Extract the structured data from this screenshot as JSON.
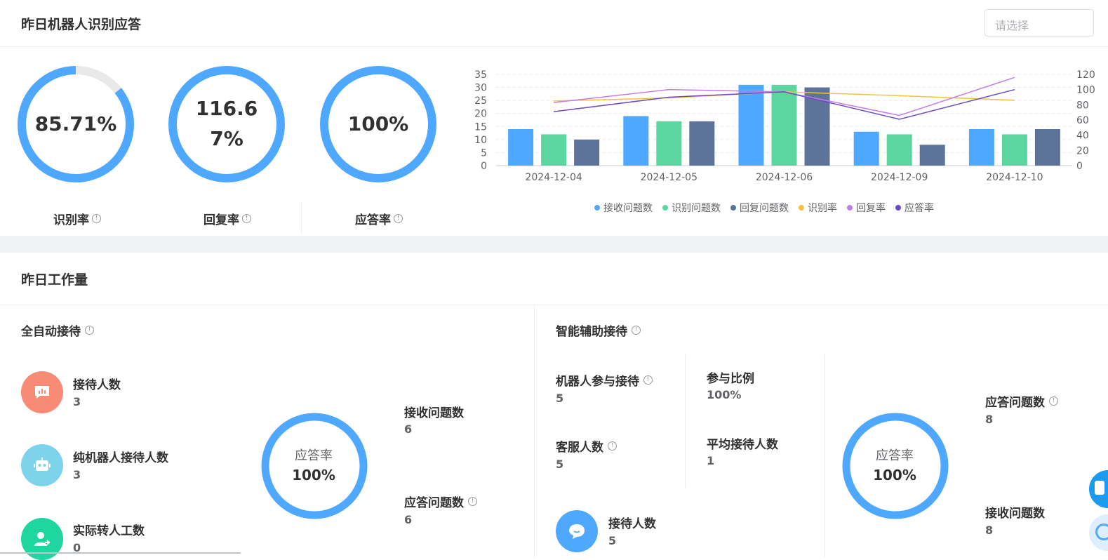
{
  "section1": {
    "title": "昨日机器人识别应答",
    "select_placeholder": "请选择",
    "rings": [
      {
        "label": "识别率",
        "value": "85.71%",
        "fraction": 0.8571
      },
      {
        "label": "回复率",
        "value_line1": "116.6",
        "value_line2": "7%",
        "fraction": 1.0
      },
      {
        "label": "应答率",
        "value": "100%",
        "fraction": 1.0
      }
    ]
  },
  "chart_data": {
    "type": "bar",
    "categories": [
      "2024-12-04",
      "2024-12-05",
      "2024-12-06",
      "2024-12-09",
      "2024-12-10"
    ],
    "left_ticks": [
      "35",
      "30",
      "25",
      "20",
      "15",
      "10",
      "5",
      "0"
    ],
    "right_ticks": [
      "120",
      "100",
      "80",
      "60",
      "40",
      "20",
      "0"
    ],
    "ylim_left": [
      0,
      35
    ],
    "ylim_right": [
      0,
      120
    ],
    "bar_series": [
      {
        "name": "接收问题数",
        "color": "#4ea8ff",
        "values": [
          14,
          19,
          31,
          13,
          14
        ]
      },
      {
        "name": "识别问题数",
        "color": "#5bd6a0",
        "values": [
          12,
          17,
          31,
          12,
          12
        ]
      },
      {
        "name": "回复问题数",
        "color": "#5e7399",
        "values": [
          10,
          17,
          30,
          8,
          14
        ]
      }
    ],
    "line_series": [
      {
        "name": "识别率",
        "color": "#f5c242",
        "values": [
          85,
          89,
          97,
          92,
          86
        ]
      },
      {
        "name": "回复率",
        "color": "#c47de8",
        "values": [
          83,
          100,
          97,
          66,
          116
        ]
      },
      {
        "name": "应答率",
        "color": "#6c4bc4",
        "values": [
          71,
          90,
          97,
          61,
          100
        ]
      }
    ],
    "grid": true,
    "legend_position": "bottom"
  },
  "section2": {
    "title": "昨日工作量",
    "auto": {
      "title": "全自动接待",
      "items": [
        {
          "label": "接待人数",
          "value": "3",
          "icon": "chart-message-icon"
        },
        {
          "label": "纯机器人接待人数",
          "value": "3",
          "icon": "robot-icon"
        },
        {
          "label": "实际转人工数",
          "value": "0",
          "icon": "user-transfer-icon"
        }
      ],
      "ring_label": "应答率",
      "ring_value": "100%",
      "ring_fraction": 1.0,
      "right_items": [
        {
          "label": "接收问题数",
          "value": "6"
        },
        {
          "label": "应答问题数",
          "value": "6"
        }
      ]
    },
    "assist": {
      "title": "智能辅助接待",
      "items": [
        {
          "label": "机器人参与接待",
          "value": "5"
        },
        {
          "label": "参与比例",
          "value": "100%"
        },
        {
          "label": "客服人数",
          "value": "5"
        },
        {
          "label": "平均接待人数",
          "value": "1"
        },
        {
          "label": "接待人数",
          "value": "5"
        }
      ],
      "ring_label": "应答率",
      "ring_value": "100%",
      "ring_fraction": 1.0,
      "right_items": [
        {
          "label": "应答问题数",
          "value": "8"
        },
        {
          "label": "接收问题数",
          "value": "8"
        }
      ]
    }
  }
}
